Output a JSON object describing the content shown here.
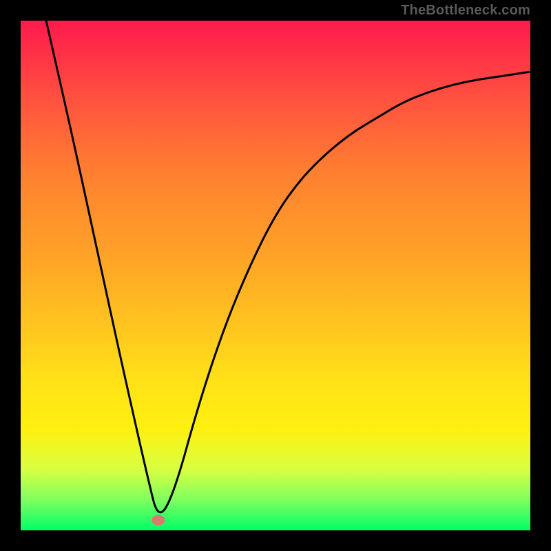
{
  "watermark": "TheBottleneck.com",
  "chart_data": {
    "type": "line",
    "title": "",
    "xlabel": "",
    "ylabel": "",
    "xlim": [
      0,
      100
    ],
    "ylim": [
      0,
      100
    ],
    "grid": false,
    "series": [
      {
        "name": "curve",
        "x": [
          5,
          10,
          15,
          20,
          25,
          27,
          30,
          35,
          40,
          45,
          50,
          55,
          60,
          65,
          70,
          75,
          80,
          85,
          90,
          95,
          100
        ],
        "values": [
          100,
          78,
          55,
          32,
          10,
          2,
          7,
          25,
          40,
          52,
          62,
          69,
          74,
          78,
          81,
          84,
          86,
          87.5,
          88.5,
          89.2,
          90
        ]
      }
    ],
    "marker": {
      "x": 27,
      "y": 2,
      "shape": "ellipse"
    }
  }
}
